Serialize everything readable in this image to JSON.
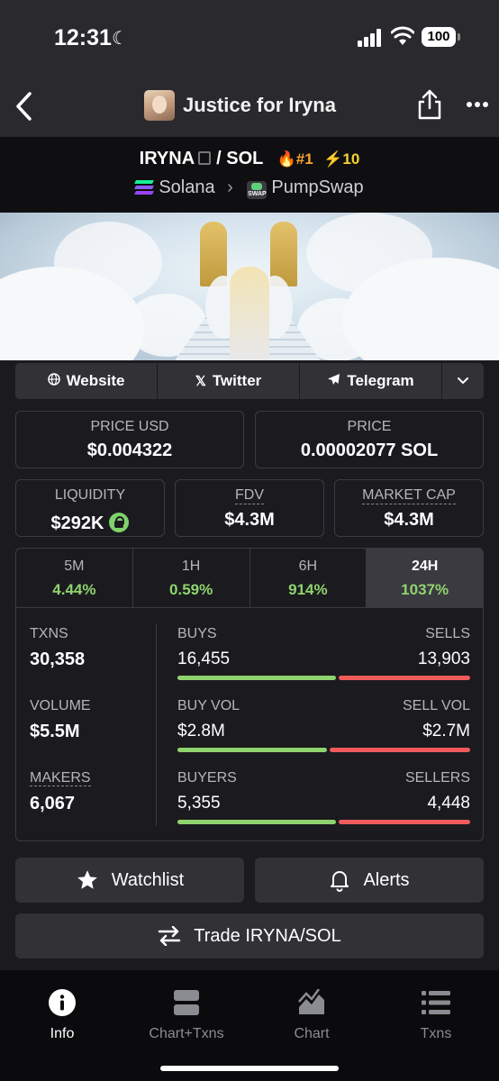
{
  "status": {
    "time": "12:31",
    "battery": "100"
  },
  "header": {
    "title": "Justice for Iryna"
  },
  "pair": {
    "base": "IRYNA",
    "quote": "/ SOL",
    "rank": "#1",
    "boosts": "10",
    "chain": "Solana",
    "dex": "PumpSwap",
    "dex_icon_text": "SWAP"
  },
  "links": [
    {
      "label": "Website",
      "icon": "globe-icon"
    },
    {
      "label": "Twitter",
      "icon": "x-icon"
    },
    {
      "label": "Telegram",
      "icon": "telegram-icon"
    }
  ],
  "prices": {
    "price_usd_label": "PRICE USD",
    "price_usd": "$0.004322",
    "price_label": "PRICE",
    "price_native": "0.00002077 SOL",
    "liquidity_label": "LIQUIDITY",
    "liquidity": "$292K",
    "fdv_label": "FDV",
    "fdv": "$4.3M",
    "mcap_label": "MARKET CAP",
    "mcap": "$4.3M"
  },
  "timeframes": [
    {
      "label": "5M",
      "change": "4.44%"
    },
    {
      "label": "1H",
      "change": "0.59%"
    },
    {
      "label": "6H",
      "change": "914%"
    },
    {
      "label": "24H",
      "change": "1037%",
      "active": true
    }
  ],
  "stats": {
    "txns_label": "TXNS",
    "txns": "30,358",
    "volume_label": "VOLUME",
    "volume": "$5.5M",
    "makers_label": "MAKERS",
    "makers": "6,067",
    "buys_label": "BUYS",
    "buys": "16,455",
    "sells_label": "SELLS",
    "sells": "13,903",
    "buy_vol_label": "BUY VOL",
    "buy_vol": "$2.8M",
    "sell_vol_label": "SELL VOL",
    "sell_vol": "$2.7M",
    "buyers_label": "BUYERS",
    "buyers": "5,355",
    "sellers_label": "SELLERS",
    "sellers": "4,448"
  },
  "actions": {
    "watchlist": "Watchlist",
    "alerts": "Alerts",
    "trade": "Trade IRYNA/SOL"
  },
  "tabbar": [
    {
      "label": "Info",
      "icon": "info-icon",
      "active": true
    },
    {
      "label": "Chart+Txns",
      "icon": "split-icon"
    },
    {
      "label": "Chart",
      "icon": "area-chart-icon"
    },
    {
      "label": "Txns",
      "icon": "list-icon"
    }
  ],
  "colors": {
    "positive": "#8fd36e",
    "negative": "#ef5b5b",
    "rank": "#f7a531",
    "boost": "#f7d431"
  }
}
